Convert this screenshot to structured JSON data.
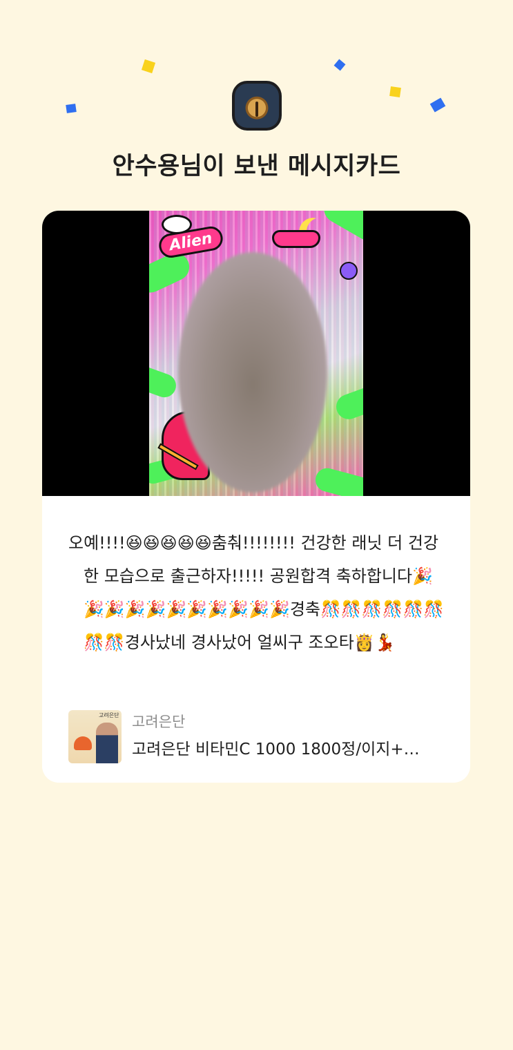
{
  "header": {
    "title": "안수용님이 보낸 메시지카드"
  },
  "confetti_colors": {
    "yellow": "#f9d21c",
    "blue": "#2f6ff0"
  },
  "card": {
    "message": "오예!!!!😆😆😆😆😆춤춰!!!!!!!! 건강한 래닛 더 건강한 모습으로 출근하자!!!!! 공원합격 축하합니다🎉🎉🎉🎉🎉🎉🎉🎉🎉🎉🎉경축🎊🎊🎊🎊🎊🎊🎊🎊경사났네 경사났어 얼씨구 조오타👸💃",
    "stickers": {
      "alien": "Alien"
    },
    "product": {
      "brand": "고려은단",
      "name": "고려은단 비타민C 1000 1800정/이지+…",
      "thumb_brand": "고려은단"
    }
  }
}
